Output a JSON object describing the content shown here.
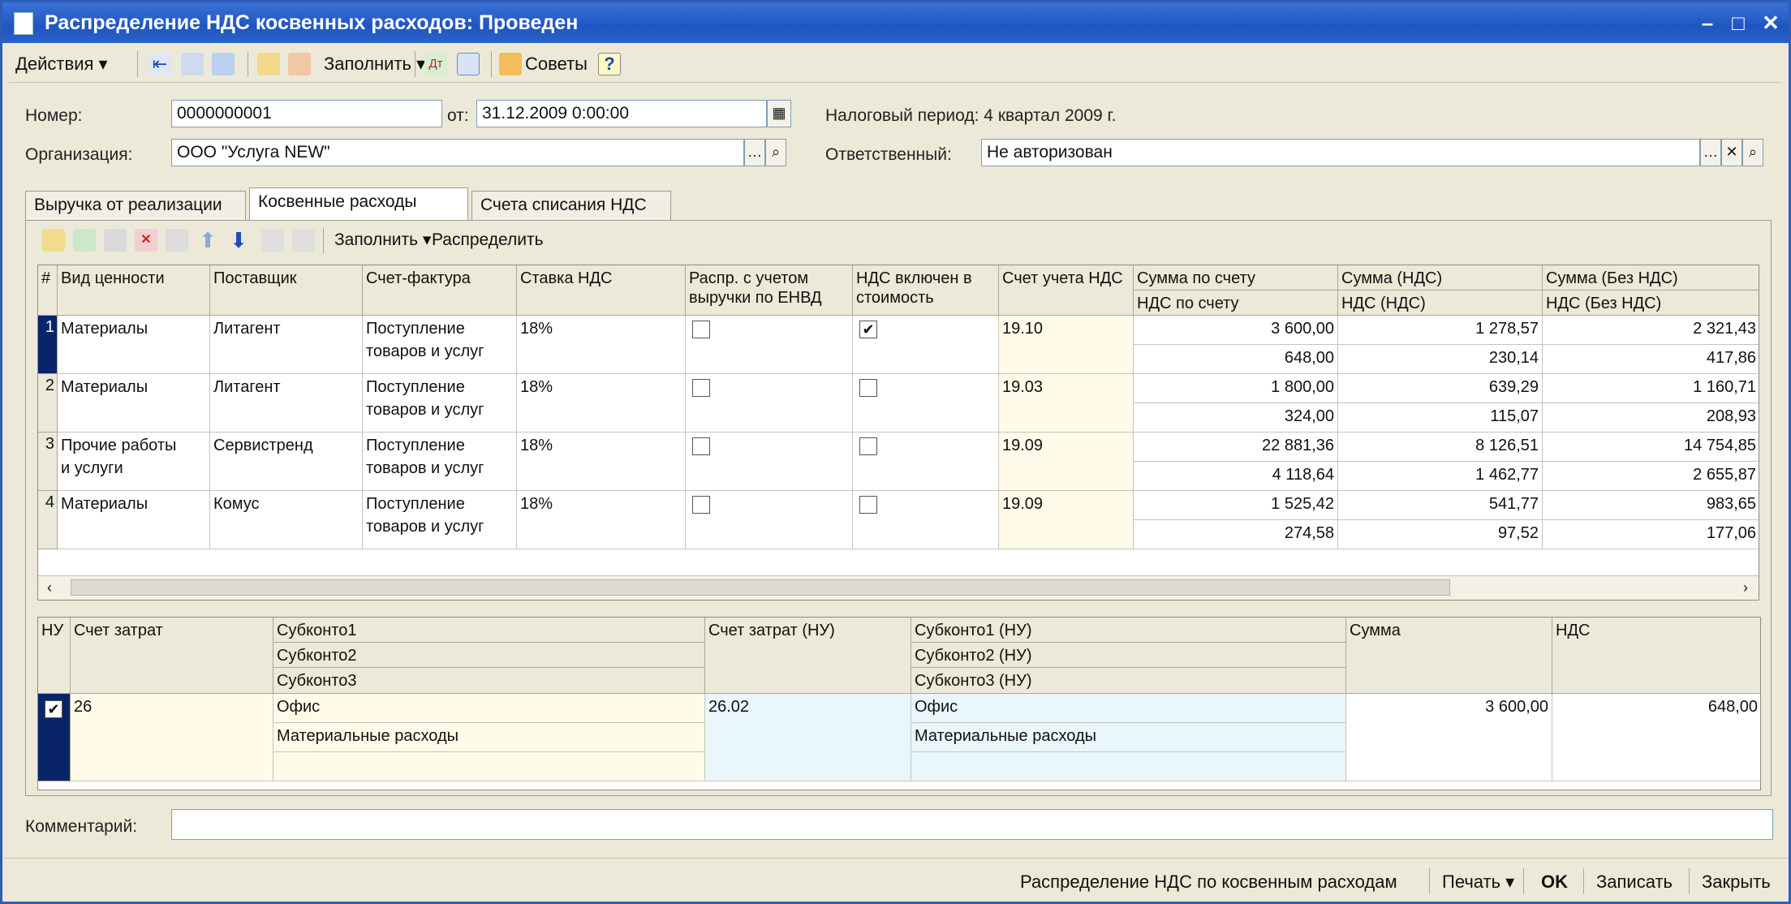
{
  "window": {
    "title": "Распределение НДС косвенных расходов: Проведен"
  },
  "toolbar": {
    "actions": "Действия ▾",
    "fill": "Заполнить ▾",
    "tips": "Советы",
    "help": "?"
  },
  "form": {
    "number_label": "Номер:",
    "number": "0000000001",
    "date_label": "от:",
    "date": "31.12.2009  0:00:00",
    "tax_period": "Налоговый период: 4 квартал 2009 г.",
    "org_label": "Организация:",
    "org": "ООО \"Услуга NEW\"",
    "resp_label": "Ответственный:",
    "resp": "Не авторизован",
    "comment_label": "Комментарий:",
    "comment": ""
  },
  "tabs": [
    "Выручка от реализации",
    "Косвенные расходы",
    "Счета списания НДС"
  ],
  "panel_toolbar": {
    "fill": "Заполнить ▾",
    "distribute": "Распределить"
  },
  "grid": {
    "headers": {
      "num": "#",
      "kind": "Вид ценности",
      "supplier": "Поставщик",
      "invoice": "Счет-фактура",
      "rate": "Ставка НДС",
      "envd": "Распр. с учетом выручки по ЕНВД",
      "incl": "НДС включен в стоимость",
      "account": "Счет учета НДС",
      "sum_top": "Сумма по счету",
      "sum_bot": "НДС по счету",
      "vat_top": "Сумма (НДС)",
      "vat_bot": "НДС (НДС)",
      "novat_top": "Сумма (Без НДС)",
      "novat_bot": "НДС (Без НДС)"
    },
    "rows": [
      {
        "n": "1",
        "kind1": "Материалы",
        "kind2": "",
        "supplier": "Литагент",
        "inv1": "Поступление",
        "inv2": "товаров и услуг",
        "rate": "18%",
        "envd": false,
        "incl": true,
        "account": "19.10",
        "sum": "3 600,00",
        "sum_vat": "648,00",
        "s_vat": "1 278,57",
        "v_vat": "230,14",
        "s_novat": "2 321,43",
        "v_novat": "417,86"
      },
      {
        "n": "2",
        "kind1": "Материалы",
        "kind2": "",
        "supplier": "Литагент",
        "inv1": "Поступление",
        "inv2": "товаров и услуг",
        "rate": "18%",
        "envd": false,
        "incl": false,
        "account": "19.03",
        "sum": "1 800,00",
        "sum_vat": "324,00",
        "s_vat": "639,29",
        "v_vat": "115,07",
        "s_novat": "1 160,71",
        "v_novat": "208,93"
      },
      {
        "n": "3",
        "kind1": "Прочие работы",
        "kind2": "и услуги",
        "supplier": "Сервистренд",
        "inv1": "Поступление",
        "inv2": "товаров и услуг",
        "rate": "18%",
        "envd": false,
        "incl": false,
        "account": "19.09",
        "sum": "22 881,36",
        "sum_vat": "4 118,64",
        "s_vat": "8 126,51",
        "v_vat": "1 462,77",
        "s_novat": "14 754,85",
        "v_novat": "2 655,87"
      },
      {
        "n": "4",
        "kind1": "Материалы",
        "kind2": "",
        "supplier": "Комус",
        "inv1": "Поступление",
        "inv2": "товаров и услуг",
        "rate": "18%",
        "envd": false,
        "incl": false,
        "account": "19.09",
        "sum": "1 525,42",
        "sum_vat": "274,58",
        "s_vat": "541,77",
        "v_vat": "97,52",
        "s_novat": "983,65",
        "v_novat": "177,06"
      }
    ]
  },
  "subgrid": {
    "headers": {
      "nu": "НУ",
      "acc": "Счет затрат",
      "sub1": "Субконто1",
      "sub2": "Субконто2",
      "sub3": "Субконто3",
      "acc_nu": "Счет затрат (НУ)",
      "sub1_nu": "Субконто1 (НУ)",
      "sub2_nu": "Субконто2 (НУ)",
      "sub3_nu": "Субконто3 (НУ)",
      "sum": "Сумма",
      "vat": "НДС"
    },
    "row": {
      "checked": true,
      "acc": "26",
      "sub1": "Офис",
      "sub2": "Материальные расходы",
      "sub3": "",
      "acc_nu": "26.02",
      "sub1_nu": "Офис",
      "sub2_nu": "Материальные расходы",
      "sub3_nu": "",
      "sum": "3 600,00",
      "vat": "648,00"
    }
  },
  "statusbar": {
    "report": "Распределение НДС по косвенным расходам",
    "print": "Печать ▾",
    "ok": "OK",
    "save": "Записать",
    "close": "Закрыть"
  }
}
